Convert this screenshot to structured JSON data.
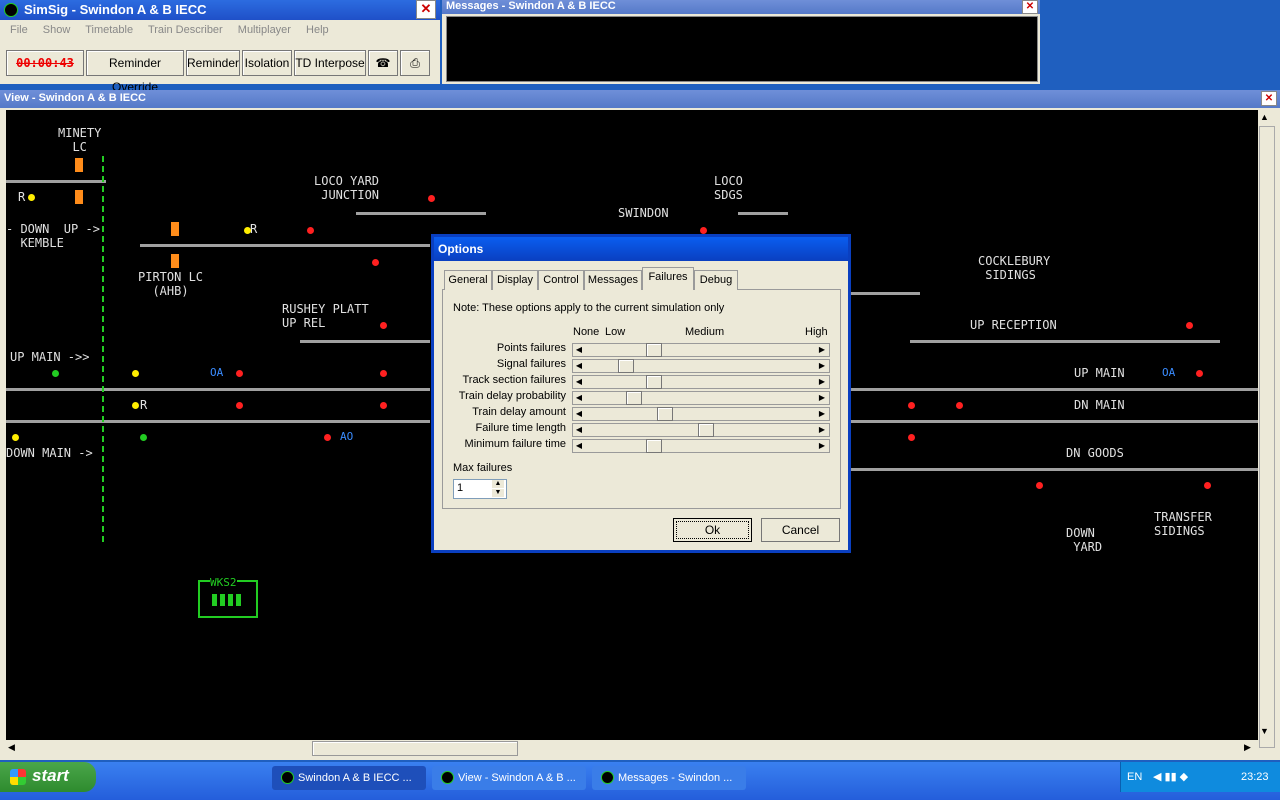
{
  "main_window": {
    "title": "SimSig - Swindon A & B IECC",
    "menu": [
      "File",
      "Show",
      "Timetable",
      "Train Describer",
      "Multiplayer",
      "Help"
    ],
    "clock": "00:00:43",
    "buttons": [
      "Reminder Override",
      "Reminder",
      "Isolation",
      "TD Interpose"
    ]
  },
  "messages_window": {
    "title": "Messages - Swindon A & B IECC"
  },
  "view_window": {
    "title": "View - Swindon A & B IECC"
  },
  "diagram": {
    "labels": [
      {
        "text": "MINETY\n  LC"
      },
      {
        "text": "R"
      },
      {
        "text": "- DOWN  UP ->\n  KEMBLE"
      },
      {
        "text": "PIRTON LC\n  (AHB)"
      },
      {
        "text": "R"
      },
      {
        "text": "LOCO YARD\n JUNCTION"
      },
      {
        "text": "RUSHEY PLATT\nUP REL"
      },
      {
        "text": "UP MAIN ->>"
      },
      {
        "text": "R"
      },
      {
        "text": "DOWN MAIN ->"
      },
      {
        "text": "SWINDON"
      },
      {
        "text": "LOCO\nSDGS"
      },
      {
        "text": "COCKLEBURY\n SIDINGS"
      },
      {
        "text": "UP RECEPTION"
      },
      {
        "text": "UP MAIN"
      },
      {
        "text": "DN MAIN"
      },
      {
        "text": "DN GOODS"
      },
      {
        "text": "DOWN\n YARD"
      },
      {
        "text": "TRANSFER\nSIDINGS"
      },
      {
        "text": "WKS2"
      }
    ],
    "blue_marks": [
      "OA",
      "AO",
      "OA"
    ]
  },
  "dialog": {
    "title": "Options",
    "tabs": [
      "General",
      "Display",
      "Control",
      "Messages",
      "Failures",
      "Debug"
    ],
    "active_tab": "Failures",
    "note": "Note: These options apply to the current simulation only",
    "scale": {
      "none": "None",
      "low": "Low",
      "medium": "Medium",
      "high": "High"
    },
    "sliders": [
      {
        "label": "Points failures",
        "level": 0.28
      },
      {
        "label": "Signal failures",
        "level": 0.15
      },
      {
        "label": "Track section failures",
        "level": 0.28
      },
      {
        "label": "Train delay probability",
        "level": 0.19
      },
      {
        "label": "Train delay amount",
        "level": 0.33
      },
      {
        "label": "Failure time length",
        "level": 0.52
      },
      {
        "label": "Minimum failure time",
        "level": 0.28
      }
    ],
    "max_failures_label": "Max failures",
    "max_failures_value": "1",
    "ok": "Ok",
    "cancel": "Cancel"
  },
  "taskbar": {
    "start": "start",
    "items": [
      "Swindon A & B IECC ...",
      "View - Swindon A & B ...",
      "Messages - Swindon ..."
    ],
    "lang": "EN",
    "time": "23:23"
  },
  "colors": {
    "accent": "#0a3fc0",
    "signal_red": "#ff2020",
    "signal_yellow": "#ffee00",
    "signal_green": "#22cc22",
    "track": "#a0a0a0",
    "lc_orange": "#ff8c1a"
  }
}
